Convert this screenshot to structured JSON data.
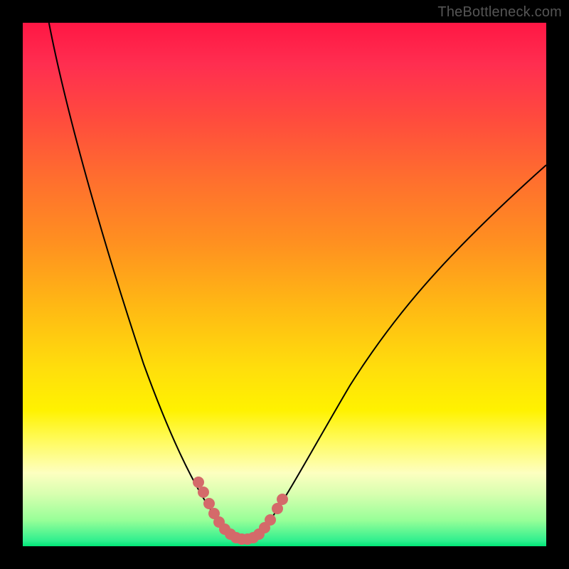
{
  "watermark": "TheBottleneck.com",
  "chart_data": {
    "type": "line",
    "title": "",
    "xlabel": "",
    "ylabel": "",
    "xlim": [
      0,
      100
    ],
    "ylim": [
      0,
      100
    ],
    "series": [
      {
        "name": "bottleneck-curve",
        "x": [
          5,
          10,
          15,
          20,
          25,
          30,
          33,
          36,
          38,
          40,
          42,
          44,
          46,
          50,
          55,
          60,
          65,
          70,
          75,
          80,
          85,
          90,
          95,
          100
        ],
        "y": [
          100,
          81,
          64,
          49,
          36,
          22,
          14,
          8,
          4,
          2,
          1,
          1,
          2,
          6,
          14,
          23,
          32,
          41,
          49,
          56,
          62,
          67,
          71,
          74
        ]
      }
    ],
    "highlight_points": {
      "name": "highlighted-dots",
      "color": "#d46a6a",
      "x": [
        33.5,
        34.5,
        36,
        37,
        38,
        39,
        40,
        41,
        42,
        43,
        44,
        45,
        46,
        47,
        48.5,
        49.5
      ],
      "y": [
        12,
        10,
        7,
        5.5,
        4,
        3,
        2,
        1.5,
        1.3,
        1.3,
        1.5,
        2,
        3,
        4,
        6.5,
        8.5
      ]
    },
    "background_gradient": {
      "type": "vertical",
      "stops": [
        {
          "pos": 0,
          "color": "#ff1744"
        },
        {
          "pos": 50,
          "color": "#ffb300"
        },
        {
          "pos": 75,
          "color": "#ffee00"
        },
        {
          "pos": 100,
          "color": "#00e676"
        }
      ]
    }
  }
}
